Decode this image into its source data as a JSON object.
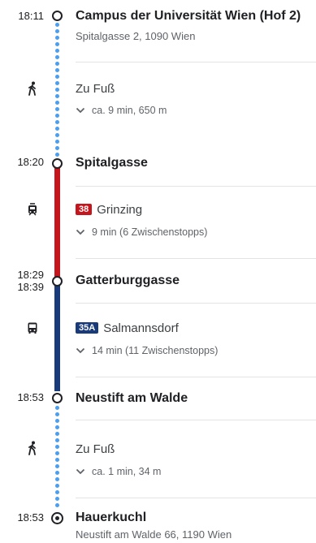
{
  "colors": {
    "walk_dots": "#4b9ef0",
    "tram_line": "#c4161c",
    "bus_line": "#1a3b7a"
  },
  "stops": [
    {
      "time": "18:11",
      "name": "Campus der Universität Wien (Hof 2)",
      "address": "Spitalgasse 2, 1090 Wien",
      "icon": "origin-circle-icon"
    },
    {
      "time": "18:20",
      "name": "Spitalgasse",
      "icon": "stop-circle-icon"
    },
    {
      "time_arr": "18:29",
      "time_dep": "18:39",
      "name": "Gatterburggasse",
      "icon": "stop-circle-icon"
    },
    {
      "time": "18:53",
      "name": "Neustift am Walde",
      "icon": "stop-circle-icon"
    },
    {
      "time": "18:53",
      "name": "Hauerkuchl",
      "address": "Neustift am Walde 66, 1190 Wien",
      "icon": "destination-target-icon"
    }
  ],
  "legs": [
    {
      "mode": "walk",
      "icon": "walking-person-icon",
      "title": "Zu Fuß",
      "detail": "ca. 9 min, 650 m"
    },
    {
      "mode": "tram",
      "icon": "tram-icon",
      "line": "38",
      "line_color": "#c4161c",
      "title": "Grinzing",
      "detail": "9 min (6 Zwischenstopps)"
    },
    {
      "mode": "bus",
      "icon": "bus-icon",
      "line": "35A",
      "line_color": "#1a3b7a",
      "title": "Salmannsdorf",
      "detail": "14 min (11 Zwischenstopps)"
    },
    {
      "mode": "walk",
      "icon": "walking-person-icon",
      "title": "Zu Fuß",
      "detail": "ca. 1 min, 34 m"
    }
  ]
}
